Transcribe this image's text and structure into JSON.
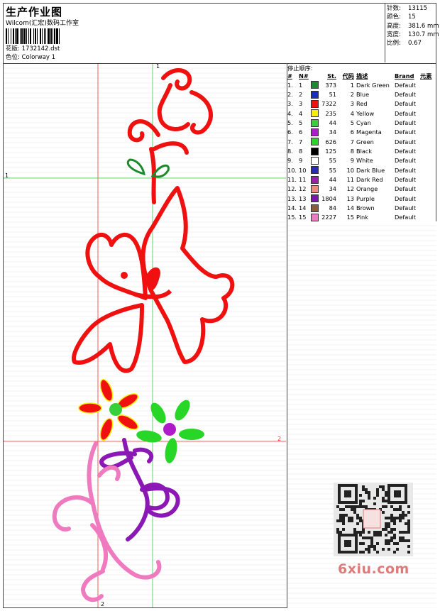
{
  "header": {
    "title": "生产作业图",
    "company": "Wilcom(汇宏)数码工作室",
    "design_label": "花版:",
    "design_value": "1732142.dst",
    "colorway_label": "色位:",
    "colorway_value": "Colorway 1"
  },
  "specs": [
    {
      "label": "针数:",
      "value": "13115"
    },
    {
      "label": "颜色:",
      "value": "15"
    },
    {
      "label": "高度:",
      "value": "381.6 mm"
    },
    {
      "label": "宽度:",
      "value": "130.7 mm"
    },
    {
      "label": "比例:",
      "value": "0.67"
    }
  ],
  "legend": {
    "title": "停止顺序:",
    "headers": {
      "idx": "#",
      "no": "N#",
      "st": "St.",
      "code": "代码",
      "desc": "描述",
      "brand": "Brand",
      "elem": "元素"
    },
    "rows": [
      {
        "idx": "1.",
        "no": "1",
        "color": "#1a8a2a",
        "st": "373",
        "code": "1",
        "desc": "Dark Green",
        "brand": "Default"
      },
      {
        "idx": "2.",
        "no": "2",
        "color": "#1c2cc4",
        "st": "51",
        "code": "2",
        "desc": "Blue",
        "brand": "Default"
      },
      {
        "idx": "3.",
        "no": "3",
        "color": "#f01010",
        "st": "7322",
        "code": "3",
        "desc": "Red",
        "brand": "Default"
      },
      {
        "idx": "4.",
        "no": "4",
        "color": "#f6f000",
        "st": "235",
        "code": "4",
        "desc": "Yellow",
        "brand": "Default"
      },
      {
        "idx": "5.",
        "no": "5",
        "color": "#36d13a",
        "st": "44",
        "code": "5",
        "desc": "Cyan",
        "brand": "Default"
      },
      {
        "idx": "6.",
        "no": "6",
        "color": "#b01bc9",
        "st": "34",
        "code": "6",
        "desc": "Magenta",
        "brand": "Default"
      },
      {
        "idx": "7.",
        "no": "7",
        "color": "#27d627",
        "st": "626",
        "code": "7",
        "desc": "Green",
        "brand": "Default"
      },
      {
        "idx": "8.",
        "no": "8",
        "color": "#000000",
        "st": "125",
        "code": "8",
        "desc": "Black",
        "brand": "Default"
      },
      {
        "idx": "9.",
        "no": "9",
        "color": "#ffffff",
        "st": "55",
        "code": "9",
        "desc": "White",
        "brand": "Default"
      },
      {
        "idx": "10.",
        "no": "10",
        "color": "#2a2ab5",
        "st": "55",
        "code": "10",
        "desc": "Dark Blue",
        "brand": "Default"
      },
      {
        "idx": "11.",
        "no": "11",
        "color": "#9b21a9",
        "st": "44",
        "code": "11",
        "desc": "Dark Red",
        "brand": "Default"
      },
      {
        "idx": "12.",
        "no": "12",
        "color": "#ef8b7e",
        "st": "34",
        "code": "12",
        "desc": "Orange",
        "brand": "Default"
      },
      {
        "idx": "13.",
        "no": "13",
        "color": "#7d16b0",
        "st": "1804",
        "code": "13",
        "desc": "Purple",
        "brand": "Default"
      },
      {
        "idx": "14.",
        "no": "14",
        "color": "#8a5a3a",
        "st": "84",
        "code": "14",
        "desc": "Brown",
        "brand": "Default"
      },
      {
        "idx": "15.",
        "no": "15",
        "color": "#f07ac0",
        "st": "2227",
        "code": "15",
        "desc": "Pink",
        "brand": "Default"
      }
    ]
  },
  "markers": {
    "top": "1",
    "left": "1",
    "right": "2",
    "bottom": "2"
  },
  "watermark": "6xiu.com"
}
